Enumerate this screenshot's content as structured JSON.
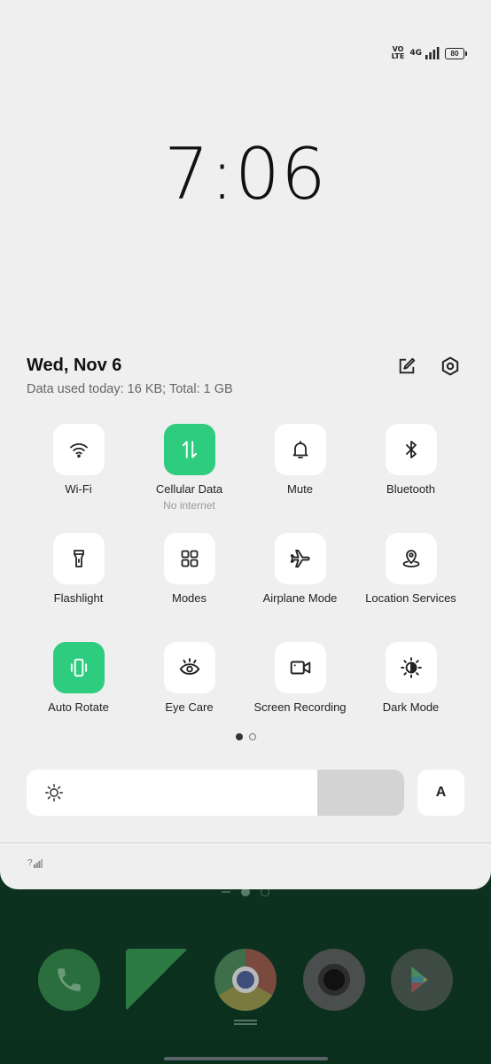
{
  "status_bar": {
    "volte_line1": "VO",
    "volte_line2": "LTE",
    "network": "4G",
    "battery": "80"
  },
  "clock": "7:06",
  "date": "Wed, Nov 6",
  "data_usage": "Data used today: 16 KB; Total: 1 GB",
  "tiles": [
    {
      "label": "Wi-Fi",
      "sub": "",
      "on": false,
      "icon": "wifi-icon"
    },
    {
      "label": "Cellular Data",
      "sub": "No internet",
      "on": true,
      "icon": "cellular-data-icon"
    },
    {
      "label": "Mute",
      "sub": "",
      "on": false,
      "icon": "bell-icon"
    },
    {
      "label": "Bluetooth",
      "sub": "",
      "on": false,
      "icon": "bluetooth-icon"
    },
    {
      "label": "Flashlight",
      "sub": "",
      "on": false,
      "icon": "flashlight-icon"
    },
    {
      "label": "Modes",
      "sub": "",
      "on": false,
      "icon": "modes-grid-icon"
    },
    {
      "label": "Airplane Mode",
      "sub": "",
      "on": false,
      "icon": "airplane-icon"
    },
    {
      "label": "Location Services",
      "sub": "",
      "on": false,
      "icon": "location-pin-icon"
    },
    {
      "label": "Auto Rotate",
      "sub": "",
      "on": true,
      "icon": "auto-rotate-icon"
    },
    {
      "label": "Eye Care",
      "sub": "",
      "on": false,
      "icon": "eye-icon"
    },
    {
      "label": "Screen Recording",
      "sub": "",
      "on": false,
      "icon": "video-camera-icon"
    },
    {
      "label": "Dark Mode",
      "sub": "",
      "on": false,
      "icon": "dark-mode-icon"
    }
  ],
  "brightness": {
    "level": 0.77,
    "auto_label": "A"
  },
  "bottom_signal": "?",
  "colors": {
    "accent": "#2ecc7e",
    "shade_bg": "#efefef",
    "tile_bg": "#ffffff",
    "home_bg": "#0f3a24"
  }
}
